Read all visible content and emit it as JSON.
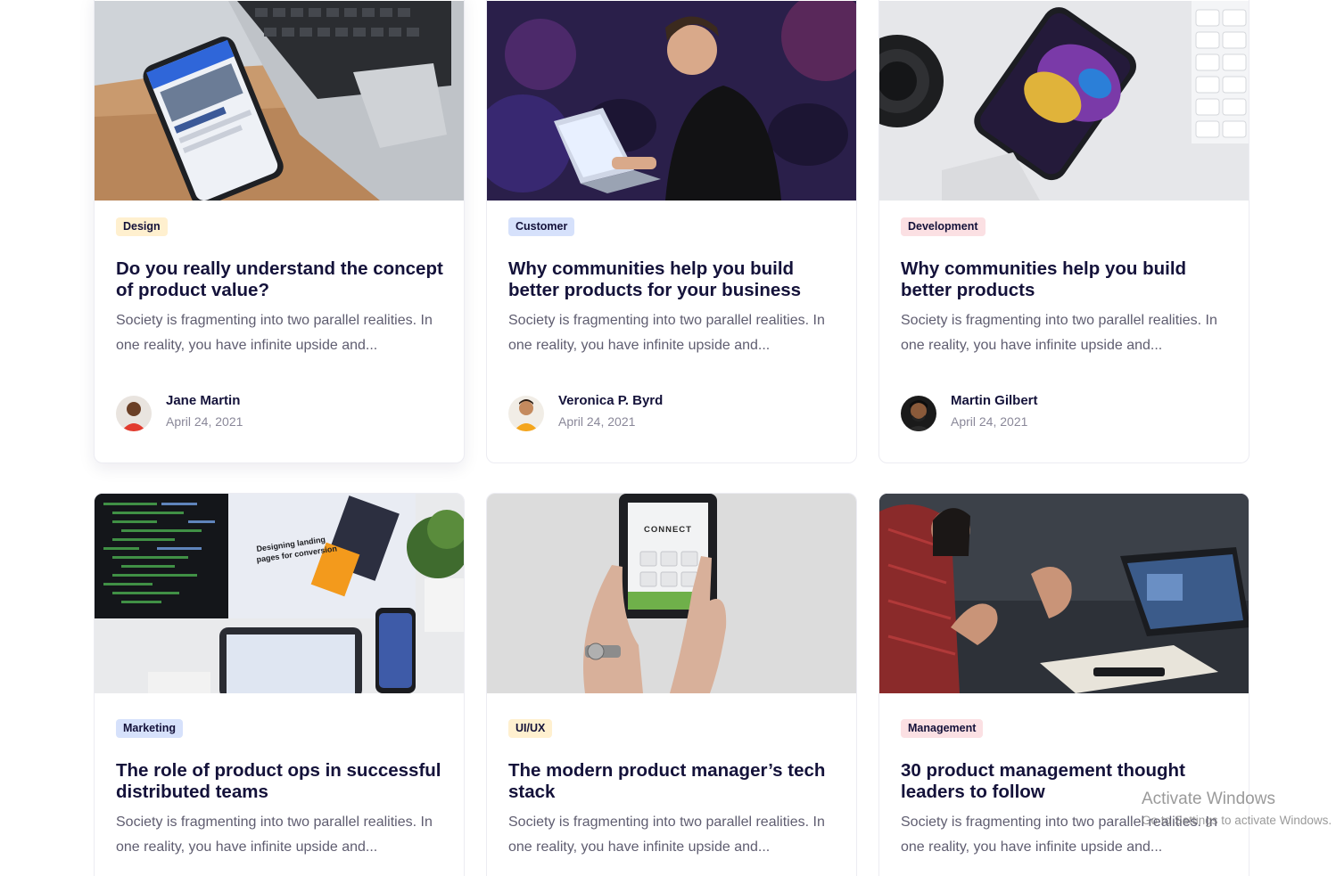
{
  "colors": {
    "title": "#14123a",
    "excerpt": "#5f5d70",
    "date": "#8a8899",
    "tag_yellow": "#fff0cf",
    "tag_blue": "#d6e1fb",
    "tag_pink": "#fbe0e3"
  },
  "posts": [
    {
      "tag": "Design",
      "title": "Do you really understand the concept of product value?",
      "excerpt": "Society is fragmenting into two parallel realities. In one reality, you have infinite upside and...",
      "author": "Jane Martin",
      "date": "April 24, 2021",
      "image_icon": "phone-laptop-photo"
    },
    {
      "tag": "Customer",
      "title": "Why communities help you build better products for your business",
      "excerpt": "Society is fragmenting into two parallel realities. In one reality, you have infinite upside and...",
      "author": "Veronica P. Byrd",
      "date": "April 24, 2021",
      "image_icon": "man-laptop-event-photo"
    },
    {
      "tag": "Development",
      "title": "Why communities help you build better products",
      "excerpt": "Society is fragmenting into two parallel realities. In one reality, you have infinite upside and...",
      "author": "Martin Gilbert",
      "date": "April 24, 2021",
      "image_icon": "phone-lens-keyboard-photo"
    },
    {
      "tag": "Marketing",
      "title": "The role of product ops in successful distributed teams",
      "excerpt": "Society is fragmenting into two parallel realities. In one reality, you have infinite upside and...",
      "image_icon": "monitor-code-photo",
      "image_text": [
        "Designing landing",
        "pages for conversion"
      ]
    },
    {
      "tag": "UI/UX",
      "title": "The modern product manager’s tech stack",
      "excerpt": "Society is fragmenting into two parallel realities. In one reality, you have infinite upside and...",
      "image_icon": "hands-tablet-photo",
      "image_text": [
        "CONNECT"
      ]
    },
    {
      "tag": "Management",
      "title": "30 product management thought leaders to follow",
      "excerpt": "Society is fragmenting into two parallel realities. In one reality, you have infinite upside and...",
      "image_icon": "meeting-laptop-photo"
    }
  ],
  "watermark": {
    "title": "Activate Windows",
    "subtitle": "Go to Settings to activate Windows."
  }
}
